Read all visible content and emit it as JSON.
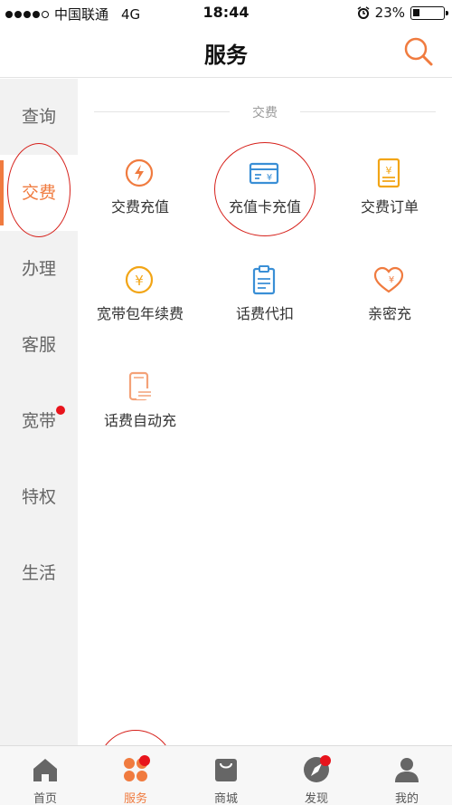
{
  "status_bar": {
    "carrier": "中国联通",
    "network": "4G",
    "time": "18:44",
    "battery_text": "23%",
    "battery_level": 0.23
  },
  "header": {
    "title": "服务",
    "search_icon": "search-icon"
  },
  "sidebar": {
    "items": [
      {
        "label": "查询"
      },
      {
        "label": "交费"
      },
      {
        "label": "办理"
      },
      {
        "label": "客服"
      },
      {
        "label": "宽带"
      },
      {
        "label": "特权"
      },
      {
        "label": "生活"
      }
    ],
    "active_index": 1
  },
  "main": {
    "section_title": "交费",
    "items": [
      {
        "label": "交费充值",
        "icon": "lightning-coin-icon"
      },
      {
        "label": "充值卡充值",
        "icon": "yuan-card-icon"
      },
      {
        "label": "交费订单",
        "icon": "order-document-icon"
      },
      {
        "label": "宽带包年续费",
        "icon": "yuan-coin-icon"
      },
      {
        "label": "话费代扣",
        "icon": "clipboard-icon"
      },
      {
        "label": "亲密充",
        "icon": "heart-yuan-icon"
      },
      {
        "label": "话费自动充",
        "icon": "phone-auto-charge-icon"
      }
    ]
  },
  "tabbar": {
    "tabs": [
      {
        "label": "首页",
        "icon": "home-icon"
      },
      {
        "label": "服务",
        "icon": "clover-icon"
      },
      {
        "label": "商城",
        "icon": "shopping-bag-icon"
      },
      {
        "label": "发现",
        "icon": "compass-icon"
      },
      {
        "label": "我的",
        "icon": "person-icon"
      }
    ],
    "active_index": 1
  },
  "colors": {
    "accent": "#f07b3f",
    "blue_icon": "#3a8fd6",
    "yellow_icon": "#f2a516",
    "badge_red": "#e8141c",
    "annotation_red": "#d6201a"
  }
}
